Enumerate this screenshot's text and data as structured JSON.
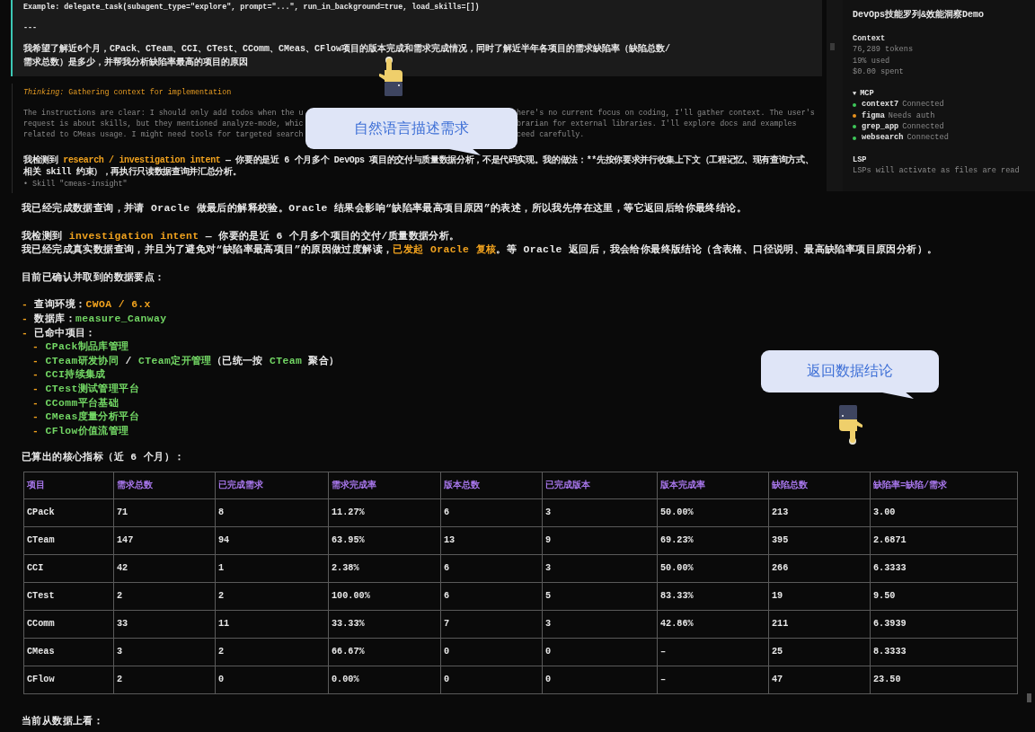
{
  "transcript": {
    "user_message": {
      "lines": [
        "Example: delegate_task(subagent_type=\"explore\", prompt=\"...\", run_in_background=true, load_skills=[])",
        "---",
        "我希望了解近6个月，CPack、CTeam、CCI、CTest、CComm、CMeas、CFlow项目的版本完成和需求完成情况，同时了解近半年各项目的需求缺陷率（缺陷总数/",
        "需求总数）是多少，并帮我分析缺陷率最高的项目的原因"
      ]
    },
    "thinking": {
      "title": "*Thinking:* Gathering context for implementation",
      "lines": [
        {
          "left": "The instructions are clear: I should only add todos when the u",
          "right": "here's no current focus on coding, I'll gather context. The user's"
        },
        {
          "left": "request is about skills, but they mentioned analyze-mode, whic",
          "right": "brarian for external libraries. I'll explore docs and examples"
        },
        {
          "left": "related to CMeas usage. I might need tools for targeted search",
          "right": "ceed carefully."
        }
      ]
    },
    "assistant_lines": [
      [
        {
          "text": "我检测到 "
        },
        {
          "text": "research / investigation intent",
          "kind": "accent"
        },
        {
          "text": " — 你要的是近 6 个月多个 DevOps 项目的交付与质量数据分析，不是代码实现。我的做法：**先按你要求并行收集上下文（工程记忆、现有查询方式、"
        }
      ],
      [
        {
          "text": "相关 skill 约束），再执行只读数据查询并汇总分析。"
        }
      ]
    ],
    "tool_line": "• Skill \"cmeas-insight\""
  },
  "sidebar": {
    "title": "DevOps技能罗列&效能洞察Demo",
    "context": {
      "heading": "Context",
      "lines": [
        "76,289 tokens",
        "19% used",
        "$0.00 spent"
      ]
    },
    "mcp": {
      "toggle": "▼",
      "heading": "MCP",
      "servers": [
        {
          "name": "context7",
          "status": "Connected",
          "color": "#3ec85a"
        },
        {
          "name": "figma",
          "status": "Needs auth",
          "color": "#e8921e"
        },
        {
          "name": "grep_app",
          "status": "Connected",
          "color": "#3ec85a"
        },
        {
          "name": "websearch",
          "status": "Connected",
          "color": "#3ec85a"
        }
      ]
    },
    "lsp": {
      "heading": "LSP",
      "note": "LSPs will activate as files are read"
    }
  },
  "response": {
    "paragraphs": [
      [
        [
          {
            "text": "我已经完成数据查询，并请 Oracle 做最后的解释校验。Oracle 结果会影响“缺陷率最高项目原因”的表述，所以我先停在这里，等它返回后给你最终结论。"
          }
        ]
      ],
      [
        [
          {
            "text": "我检测到 "
          },
          {
            "text": "investigation intent",
            "kind": "accent"
          },
          {
            "text": " — 你要的是近 6 个月多个项目的交付/质量数据分析。"
          }
        ],
        [
          {
            "text": "我已经完成真实数据查询，并且为了避免对“缺陷率最高项目”的原因做过度解读，"
          },
          {
            "text": "已发起 Oracle 复核",
            "kind": "accent"
          },
          {
            "text": "。等 Oracle 返回后，我会给你最终版结论（含表格、口径说明、最高缺陷率项目原因分析）。"
          }
        ]
      ],
      [
        [
          {
            "text": "目前已确认并取到的数据要点："
          }
        ]
      ]
    ],
    "facts": [
      {
        "segments": [
          {
            "text": "- ",
            "kind": "dash"
          },
          {
            "text": "查询环境："
          },
          {
            "text": "CWOA / 6.x",
            "kind": "accent"
          }
        ]
      },
      {
        "segments": [
          {
            "text": "- ",
            "kind": "dash"
          },
          {
            "text": "数据库："
          },
          {
            "text": "measure_Canway",
            "kind": "code"
          }
        ]
      },
      {
        "segments": [
          {
            "text": "- ",
            "kind": "dash"
          },
          {
            "text": "已命中项目："
          }
        ],
        "children": [
          {
            "segments": [
              {
                "text": "- ",
                "kind": "dash"
              },
              {
                "text": "CPack制品库管理",
                "kind": "code"
              }
            ]
          },
          {
            "segments": [
              {
                "text": "- ",
                "kind": "dash"
              },
              {
                "text": "CTeam研发协同",
                "kind": "code"
              },
              {
                "text": " / "
              },
              {
                "text": "CTeam定开管理",
                "kind": "code"
              },
              {
                "text": "（已统一按 "
              },
              {
                "text": "CTeam",
                "kind": "code"
              },
              {
                "text": " 聚合）"
              }
            ]
          },
          {
            "segments": [
              {
                "text": "- ",
                "kind": "dash"
              },
              {
                "text": "CCI持续集成",
                "kind": "code"
              }
            ]
          },
          {
            "segments": [
              {
                "text": "- ",
                "kind": "dash"
              },
              {
                "text": "CTest测试管理平台",
                "kind": "code"
              }
            ]
          },
          {
            "segments": [
              {
                "text": "- ",
                "kind": "dash"
              },
              {
                "text": "CComm平台基础",
                "kind": "code"
              }
            ]
          },
          {
            "segments": [
              {
                "text": "- ",
                "kind": "dash"
              },
              {
                "text": "CMeas度量分析平台",
                "kind": "code"
              }
            ]
          },
          {
            "segments": [
              {
                "text": "- ",
                "kind": "dash"
              },
              {
                "text": "CFlow价值流管理",
                "kind": "code"
              }
            ]
          }
        ]
      }
    ],
    "table_caption": "已算出的核心指标（近 6 个月）：",
    "table": {
      "columns": [
        "项目",
        "需求总数",
        "已完成需求",
        "需求完成率",
        "版本总数",
        "已完成版本",
        "版本完成率",
        "缺陷总数",
        "缺陷率=缺陷/需求"
      ],
      "rows": [
        [
          "CPack",
          "71",
          "8",
          "11.27%",
          "6",
          "3",
          "50.00%",
          "213",
          "3.00"
        ],
        [
          "CTeam",
          "147",
          "94",
          "63.95%",
          "13",
          "9",
          "69.23%",
          "395",
          "2.6871"
        ],
        [
          "CCI",
          "42",
          "1",
          "2.38%",
          "6",
          "3",
          "50.00%",
          "266",
          "6.3333"
        ],
        [
          "CTest",
          "2",
          "2",
          "100.00%",
          "6",
          "5",
          "83.33%",
          "19",
          "9.50"
        ],
        [
          "CComm",
          "33",
          "11",
          "33.33%",
          "7",
          "3",
          "42.86%",
          "211",
          "6.3939"
        ],
        [
          "CMeas",
          "3",
          "2",
          "66.67%",
          "0",
          "0",
          "–",
          "25",
          "8.3333"
        ],
        [
          "CFlow",
          "2",
          "0",
          "0.00%",
          "0",
          "0",
          "–",
          "47",
          "23.50"
        ]
      ]
    },
    "closing": "当前从数据上看："
  },
  "callouts": [
    {
      "text": "自然语言描述需求",
      "kind": "up"
    },
    {
      "text": "返回数据结论",
      "kind": "down"
    }
  ]
}
